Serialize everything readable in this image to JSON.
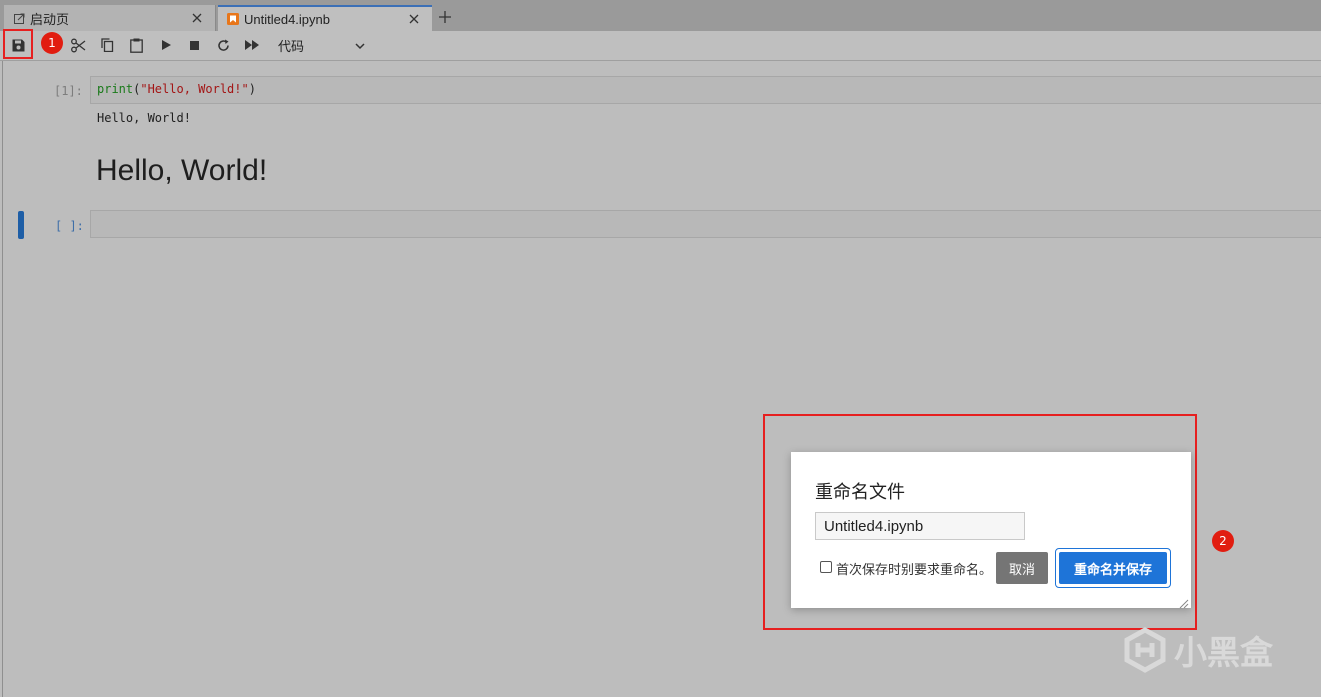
{
  "tabs": {
    "launcher_label": "启动页",
    "notebook_label": "Untitled4.ipynb"
  },
  "toolbar": {
    "cell_type": "代码",
    "badge_1": "1"
  },
  "notebook": {
    "cell1_prompt": "[1]:",
    "cell1_code_fn": "print",
    "cell1_code_open": "(",
    "cell1_code_str": "\"Hello, World!\"",
    "cell1_code_close": ")",
    "cell1_output": "Hello, World!",
    "markdown_heading": "Hello, World!",
    "cell2_prompt": "[ ]:"
  },
  "dialog": {
    "title": "重命名文件",
    "filename_value": "Untitled4.ipynb",
    "checkbox_label": "首次保存时别要求重命名。",
    "cancel_label": "取消",
    "save_label": "重命名并保存",
    "badge_2": "2"
  },
  "watermark": {
    "text": "小黑盒"
  },
  "colors": {
    "accent": "#1e74d8",
    "highlight_red": "#e62020",
    "active_cell": "#1e5ea6"
  }
}
